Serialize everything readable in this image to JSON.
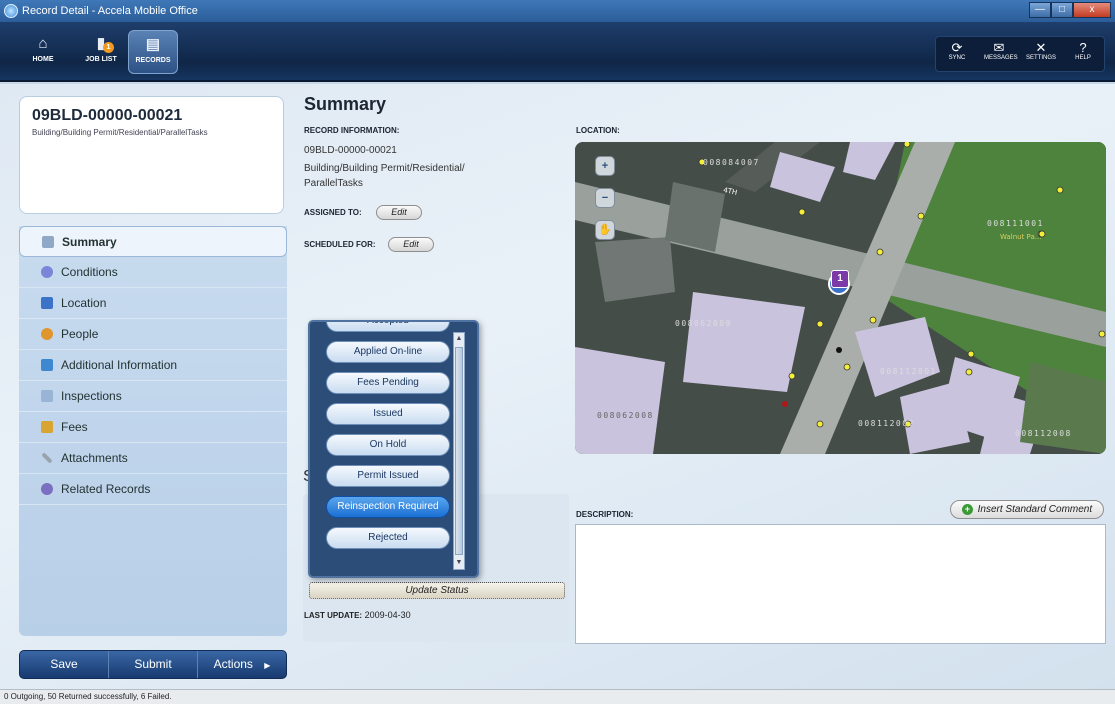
{
  "window": {
    "title": "Record Detail - Accela Mobile Office",
    "min": "—",
    "max": "□",
    "close": "x"
  },
  "topnav": {
    "home": "HOME",
    "joblist": "JOB LIST",
    "joblist_badge": "1",
    "records": "RECORDS",
    "sync": "SYNC",
    "messages": "MESSAGES",
    "settings": "SETTINGS",
    "help": "HELP"
  },
  "record": {
    "id": "09BLD-00000-00021",
    "type": "Building/Building Permit/Residential/ParallelTasks"
  },
  "sidebar": {
    "items": [
      {
        "label": "Summary",
        "icon": "summary-icon",
        "color": "#8fa8c8"
      },
      {
        "label": "Conditions",
        "icon": "conditions-icon",
        "color": "#7b86d8"
      },
      {
        "label": "Location",
        "icon": "location-icon",
        "color": "#3a73c8"
      },
      {
        "label": "People",
        "icon": "people-icon",
        "color": "#e0962f"
      },
      {
        "label": "Additional Information",
        "icon": "additional-info-icon",
        "color": "#3d88d0"
      },
      {
        "label": "Inspections",
        "icon": "inspections-icon",
        "color": "#9ab4d6"
      },
      {
        "label": "Fees",
        "icon": "fees-icon",
        "color": "#d8a533"
      },
      {
        "label": "Attachments",
        "icon": "attachments-icon",
        "color": "#9aa3ad"
      },
      {
        "label": "Related Records",
        "icon": "related-records-icon",
        "color": "#7a6fc0"
      }
    ]
  },
  "actions": {
    "save": "Save",
    "submit": "Submit",
    "actions": "Actions"
  },
  "summary": {
    "title": "Summary",
    "record_info_label": "RECORD INFORMATION:",
    "record_id": "09BLD-00000-00021",
    "record_type_line1": "Building/Building Permit/Residential/",
    "record_type_line2": "ParallelTasks",
    "assigned_label": "ASSIGNED TO:",
    "scheduled_label": "SCHEDULED FOR:",
    "edit": "Edit",
    "status_partial": "S",
    "update_status": "Update Status",
    "last_update_label": "LAST UPDATE:",
    "last_update_value": "2009-04-30"
  },
  "status_dropdown": {
    "options": [
      "Accepted",
      "Applied On-line",
      "Fees Pending",
      "Issued",
      "On Hold",
      "Permit Issued",
      "Reinspection Required",
      "Rejected"
    ],
    "selected": "Reinspection Required"
  },
  "location": {
    "label": "LOCATION:",
    "parcels": [
      "008084007",
      "008111001",
      "008062009",
      "008112001",
      "008062008",
      "008112002",
      "008112008"
    ],
    "marker": "1",
    "street": "4TH",
    "park_label": "Walnut Pa..."
  },
  "description": {
    "label": "DESCRIPTION:",
    "insert_comment": "Insert Standard Comment"
  },
  "statusbar": {
    "text": "0 Outgoing, 50 Returned successfully, 6 Failed."
  }
}
